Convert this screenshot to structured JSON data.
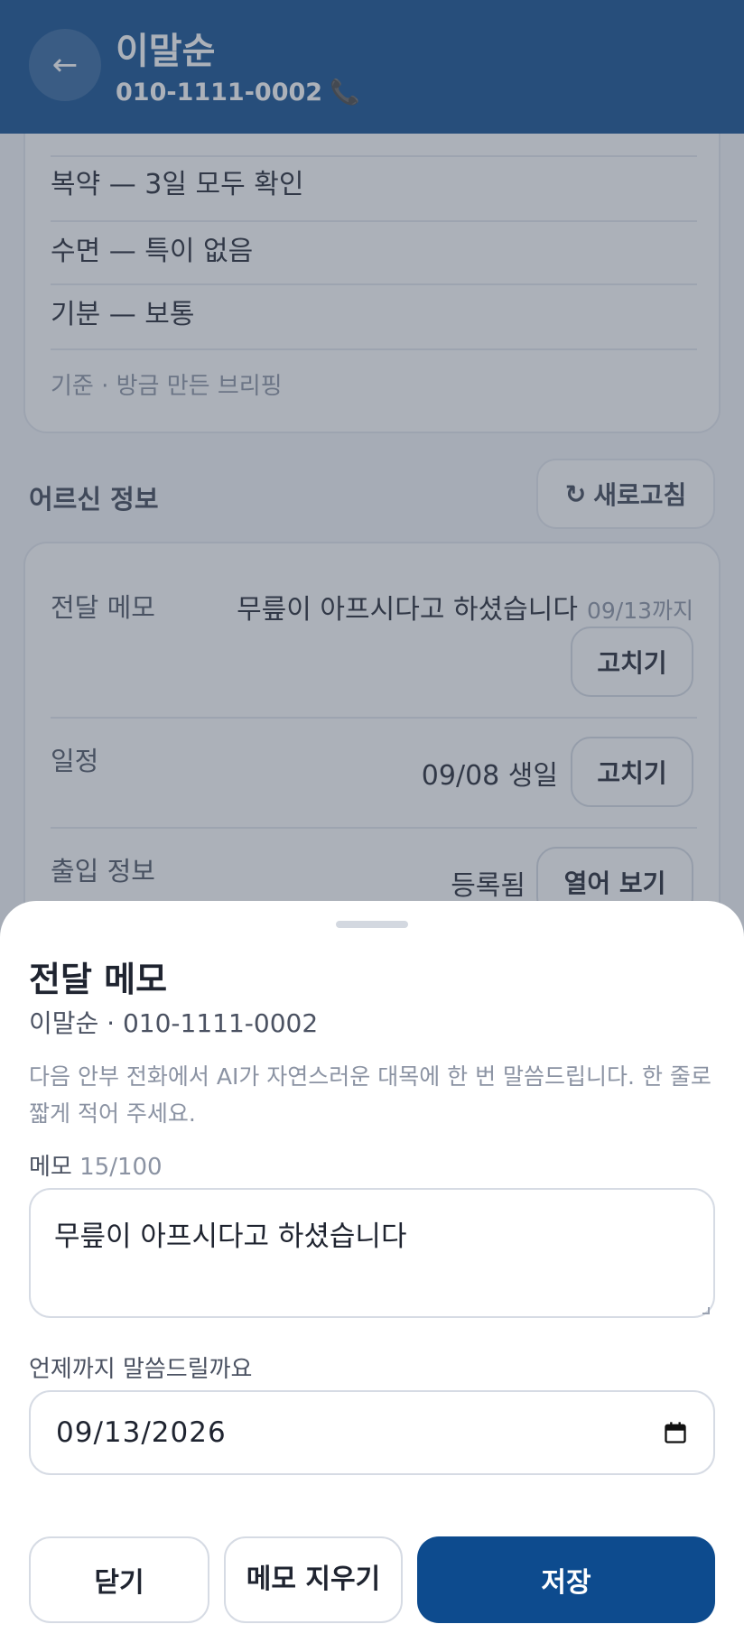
{
  "header": {
    "back_icon": "←",
    "name": "이말순",
    "phone": "010-1111-0002",
    "phone_icon": "📞"
  },
  "briefing": {
    "rows": [
      "복약 — 3일 모두 확인",
      "수면 — 특이 없음",
      "기분 — 보통"
    ],
    "footer": "기준 · 방금 만든 브리핑"
  },
  "elder_info": {
    "title": "어르신 정보",
    "refresh_icon": "↻",
    "refresh_label": "새로고침",
    "memo_label": "전달 메모",
    "memo_value": "무릎이 아프시다고 하셨습니다",
    "memo_until": "09/13까지",
    "edit_label": "고치기",
    "schedule_label": "일정",
    "schedule_value": "09/08 생일",
    "access_label": "출입 정보",
    "access_value": "등록됨",
    "open_label": "열어 보기"
  },
  "sheet": {
    "title": "전달 메모",
    "subtitle": "이말순 · 010-1111-0002",
    "description": "다음 안부 전화에서 AI가 자연스러운 대목에 한 번 말씀드립니다. 한 줄로 짧게 적어 주세요.",
    "memo_label": "메모",
    "memo_count": "15/100",
    "memo_value": "무릎이 아프시다고 하셨습니다",
    "date_label": "언제까지 말씀드릴까요",
    "date_value": "09/13/2026",
    "close_label": "닫기",
    "clear_label": "메모 지우기",
    "save_label": "저장"
  },
  "colors": {
    "header_bg": "#0d4b8e",
    "primary": "#0d4b8e",
    "overlay": "rgba(70,82,100,0.45)"
  }
}
